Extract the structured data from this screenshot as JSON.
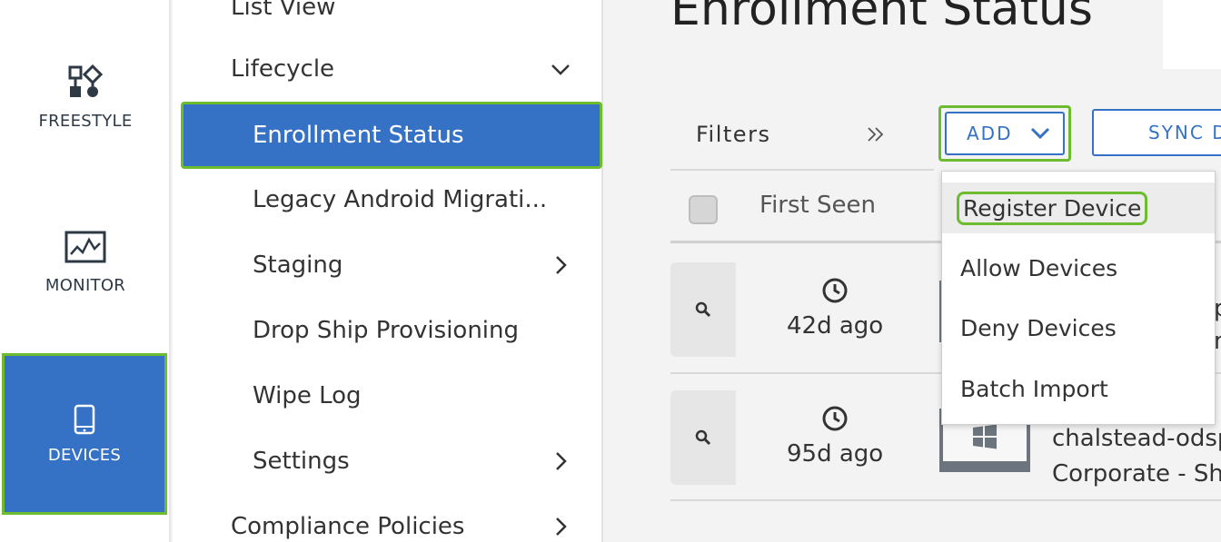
{
  "rail": {
    "freestyle_label": "FREESTYLE",
    "monitor_label": "MONITOR",
    "devices_label": "DEVICES"
  },
  "subnav": {
    "items": [
      {
        "label": "List View"
      },
      {
        "label": "Lifecycle"
      },
      {
        "label": "Enrollment Status"
      },
      {
        "label": "Legacy Android Migrati..."
      },
      {
        "label": "Staging"
      },
      {
        "label": "Drop Ship Provisioning"
      },
      {
        "label": "Wipe Log"
      },
      {
        "label": "Settings"
      },
      {
        "label": "Compliance Policies"
      }
    ]
  },
  "main": {
    "title": "Enrollment Status",
    "filters_label": "Filters",
    "add_label": "ADD",
    "sync_label": "SYNC D",
    "table": {
      "first_seen_header": "First Seen",
      "rows": [
        {
          "first_seen": "42d ago",
          "edge_line1": "p",
          "edge_line2": "n"
        },
        {
          "first_seen": "95d ago",
          "name": "chalstead-odsp",
          "ownership": "Corporate - Sh"
        }
      ]
    },
    "add_menu": {
      "items": [
        "Register Device",
        "Allow Devices",
        "Deny Devices",
        "Batch Import"
      ]
    }
  },
  "colors": {
    "accent_blue": "#3572c6",
    "highlight_green": "#6dbb2e"
  }
}
